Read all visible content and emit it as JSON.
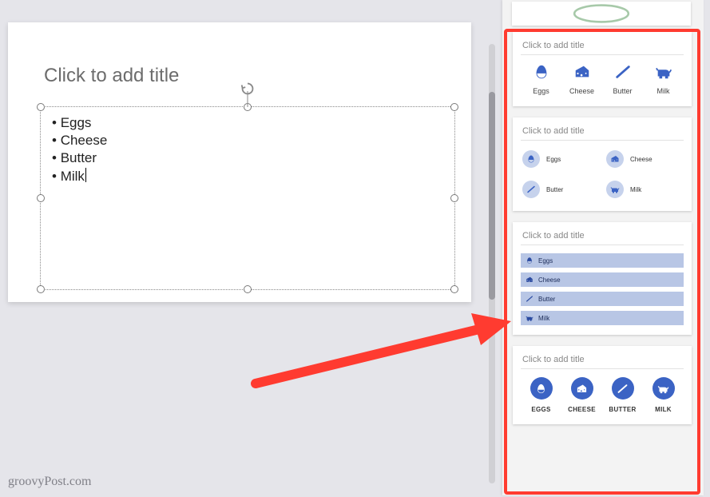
{
  "slide": {
    "title_placeholder": "Click to add title",
    "bullets": [
      "Eggs",
      "Cheese",
      "Butter",
      "Milk"
    ]
  },
  "designIdeas": {
    "card_title_placeholder": "Click to add title",
    "items": [
      {
        "label": "Eggs",
        "icon": "egg"
      },
      {
        "label": "Cheese",
        "icon": "cheese"
      },
      {
        "label": "Butter",
        "icon": "butter"
      },
      {
        "label": "Milk",
        "icon": "cow"
      }
    ],
    "items_upper": [
      {
        "label": "EGGS",
        "icon": "egg"
      },
      {
        "label": "CHEESE",
        "icon": "cheese"
      },
      {
        "label": "BUTTER",
        "icon": "butter"
      },
      {
        "label": "MILK",
        "icon": "cow"
      }
    ]
  },
  "colors": {
    "accent": "#3b63c4",
    "accent_light": "#b8c6e5",
    "accent_circle": "#c6d2ec",
    "highlight": "#ff3b30"
  },
  "watermark": "groovyPost.com"
}
